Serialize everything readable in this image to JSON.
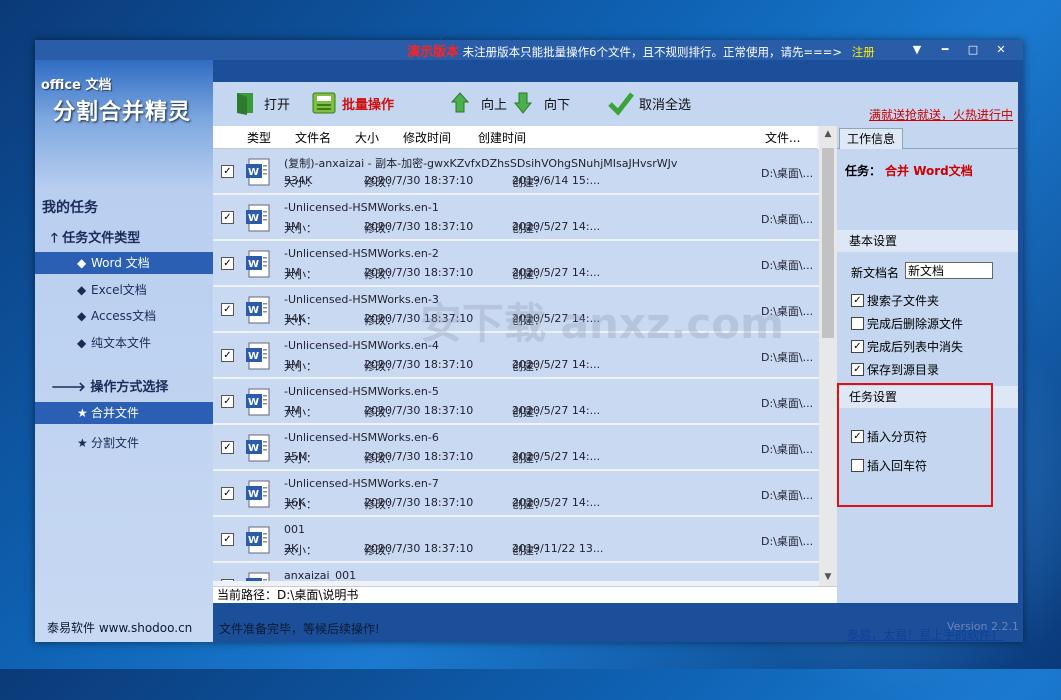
{
  "title_bar": {
    "demo_label": "演示版本",
    "message": "未注册版本只能批量操作6个文件，且不规则排行。正常使用，请先===>",
    "register_label": "注册"
  },
  "logo": {
    "line1": "office 文档",
    "line2": "分割合并精灵"
  },
  "sidebar": {
    "title": "我的任务",
    "sections": [
      {
        "heading": "任务文件类型",
        "items": [
          "Word 文档",
          "Excel文档",
          "Access文档",
          "纯文本文件"
        ],
        "selected": 0
      },
      {
        "heading": "操作方式选择",
        "items": [
          "合并文件",
          "分割文件"
        ],
        "selected": 0
      }
    ],
    "footer": "泰易软件 www.shodoo.cn"
  },
  "toolbar": {
    "open": "打开",
    "batch": "批量操作",
    "up": "向上",
    "down": "向下",
    "deselect_all": "取消全选",
    "promo": "满就送抢就送，火热进行中"
  },
  "file_list": {
    "headers": [
      "类型",
      "文件名",
      "大小",
      "修改时间",
      "创建时间",
      "文件..."
    ],
    "size_label": "大小：",
    "modified_label": "修改：",
    "created_label": "创建：",
    "rows": [
      {
        "name": "(复制)-anxaizai - 副本-加密-gwxKZvfxDZhsSDsihVOhgSNuhjMIsaJHvsrWJv",
        "size": "534K",
        "modified": "2020/7/30 18:37:10",
        "created": "2019/6/14 15:...",
        "path": "D:\\桌面\\..."
      },
      {
        "name": "-Unlicensed-HSMWorks.en-1",
        "size": "1M",
        "modified": "2020/7/30 18:37:10",
        "created": "2020/5/27 14:...",
        "path": "D:\\桌面\\..."
      },
      {
        "name": "-Unlicensed-HSMWorks.en-2",
        "size": "1M",
        "modified": "2020/7/30 18:37:10",
        "created": "2020/5/27 14:...",
        "path": "D:\\桌面\\..."
      },
      {
        "name": "-Unlicensed-HSMWorks.en-3",
        "size": "14K",
        "modified": "2020/7/30 18:37:10",
        "created": "2020/5/27 14:...",
        "path": "D:\\桌面\\..."
      },
      {
        "name": "-Unlicensed-HSMWorks.en-4",
        "size": "1M",
        "modified": "2020/7/30 18:37:10",
        "created": "2020/5/27 14:...",
        "path": "D:\\桌面\\..."
      },
      {
        "name": "-Unlicensed-HSMWorks.en-5",
        "size": "7M",
        "modified": "2020/7/30 18:37:10",
        "created": "2020/5/27 14:...",
        "path": "D:\\桌面\\..."
      },
      {
        "name": "-Unlicensed-HSMWorks.en-6",
        "size": "25M",
        "modified": "2020/7/30 18:37:10",
        "created": "2020/5/27 14:...",
        "path": "D:\\桌面\\..."
      },
      {
        "name": "-Unlicensed-HSMWorks.en-7",
        "size": "16K",
        "modified": "2020/7/30 18:37:10",
        "created": "2020/5/27 14:...",
        "path": "D:\\桌面\\..."
      },
      {
        "name": "001",
        "size": "2K",
        "modified": "2020/7/30 18:37:10",
        "created": "2019/11/22 13...",
        "path": "D:\\桌面\\..."
      },
      {
        "name": "anxaizai_001",
        "size": "",
        "modified": "",
        "created": "",
        "path": "D:\\桌面\\..."
      }
    ],
    "current_path_label": "当前路径：",
    "current_path": "D:\\桌面\\说明书"
  },
  "status_bar": {
    "message": "文件准备完毕，等候后续操作!",
    "version": "Version 2.2.1"
  },
  "right_panel": {
    "tab": "工作信息",
    "task_label": "任务：",
    "task_value": "合并 Word文档",
    "basic_settings": "基本设置",
    "new_name_label": "新文档名",
    "new_name_value": "新文档",
    "options": [
      {
        "label": "搜索子文件夹",
        "checked": true
      },
      {
        "label": "完成后删除源文件",
        "checked": false
      },
      {
        "label": "完成后列表中消失",
        "checked": true
      },
      {
        "label": "保存到源目录",
        "checked": true
      }
    ],
    "task_settings": "任务设置",
    "task_options": [
      {
        "label": "插入分页符",
        "checked": true
      },
      {
        "label": "插入回车符",
        "checked": false
      }
    ],
    "easy_link": "泰易，太易！易上手的软件！"
  },
  "watermark": "安下载 anxz.com",
  "colors": {
    "accent_red": "#cc0000",
    "selected_nav": "#2b5fb4",
    "row_bg": "#c8d9f1"
  }
}
